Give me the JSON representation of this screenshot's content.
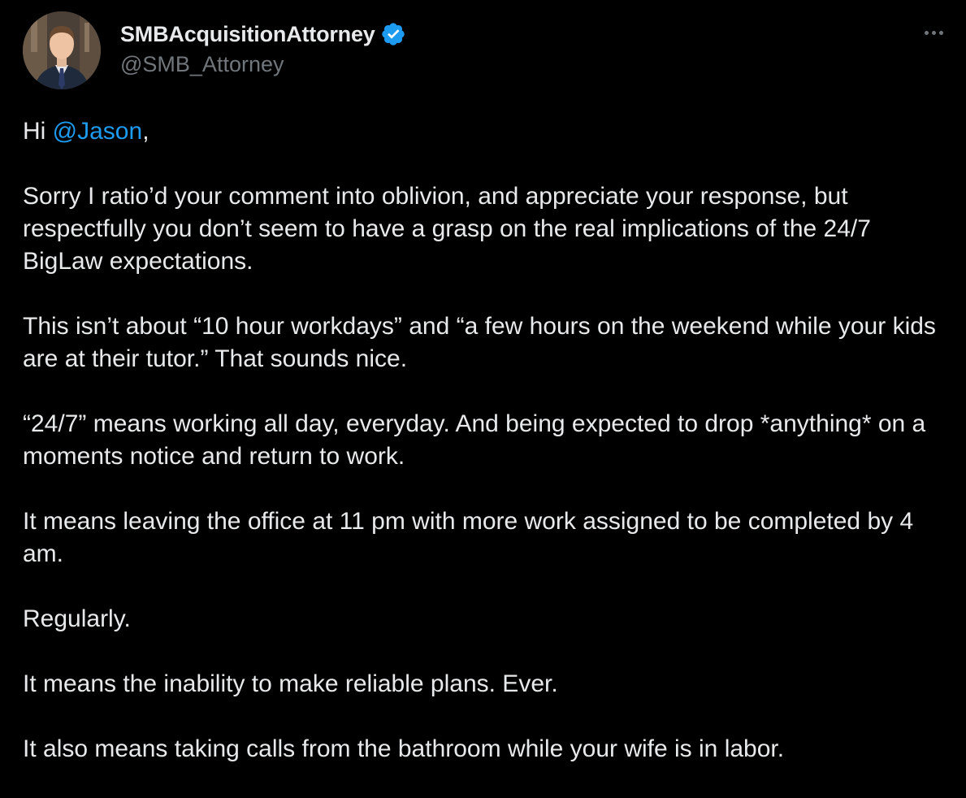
{
  "author": {
    "display_name": "SMBAcquisitionAttorney",
    "handle": "@SMB_Attorney",
    "verified": true,
    "verified_color": "#1d9bf0",
    "avatar_icon": "profile-photo-man-in-suit"
  },
  "menu": {
    "more_icon": "more-horizontal-icon"
  },
  "tweet": {
    "greeting_prefix": "Hi ",
    "mention": "@Jason",
    "greeting_suffix": ",",
    "paragraphs": [
      "Sorry I ratio’d your comment into oblivion, and appreciate your response, but respectfully you don’t seem to have a grasp on the real implications of the 24/7 BigLaw expectations.",
      "This isn’t about “10 hour workdays” and “a few hours on the weekend while your kids are at their tutor.” That sounds nice.",
      "“24/7” means working all day, everyday. And being expected to drop *anything* on a moments notice and return to work.",
      "It means leaving the office at 11 pm with more work assigned to be completed by 4 am.",
      "Regularly.",
      "It means the inability to make reliable plans. Ever.",
      "It also means taking calls from the bathroom while your wife is in labor."
    ]
  },
  "colors": {
    "background": "#000000",
    "text": "#e7e9ea",
    "secondary_text": "#71767b",
    "link": "#1d9bf0"
  }
}
